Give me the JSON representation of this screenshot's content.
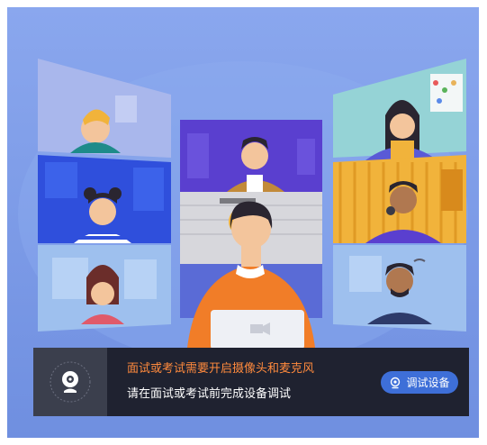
{
  "notice": {
    "warning_text": "面试或考试需要开启摄像头和麦克风",
    "instruction_text": "请在面试或考试前完成设备调试",
    "button_label": "调试设备",
    "button_icon": "webcam-icon",
    "status_icon": "webcam-icon"
  },
  "colors": {
    "background": "#7b9ae3",
    "bar": "#1f2230",
    "warning": "#ff8a3d",
    "button": "#3e6fd8"
  }
}
